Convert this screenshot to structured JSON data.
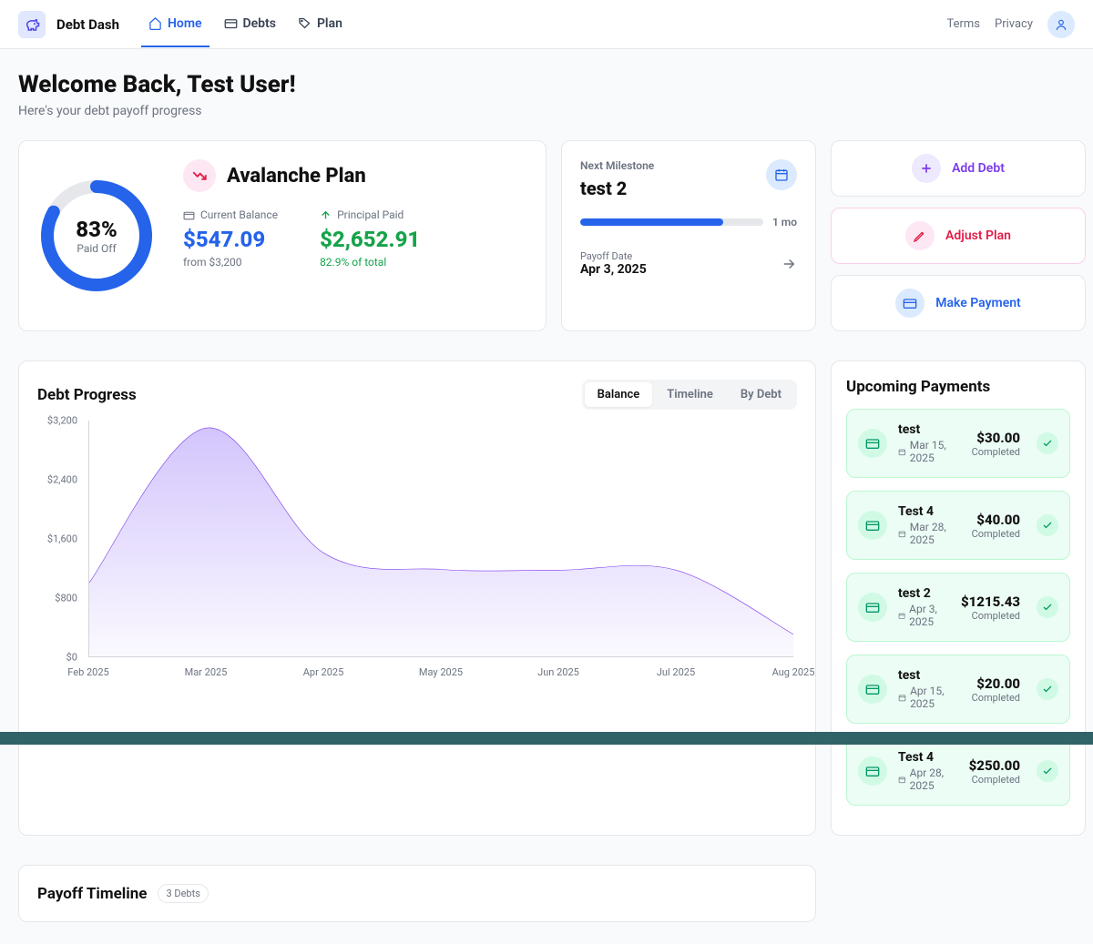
{
  "brand": "Debt Dash",
  "nav": {
    "items": [
      {
        "label": "Home",
        "active": true,
        "icon": "home"
      },
      {
        "label": "Debts",
        "active": false,
        "icon": "card"
      },
      {
        "label": "Plan",
        "active": false,
        "icon": "tag"
      }
    ],
    "links": [
      "Terms",
      "Privacy"
    ]
  },
  "welcome": {
    "title": "Welcome Back, Test User!",
    "subtitle": "Here's your debt payoff progress"
  },
  "hero": {
    "progress_pct": "83%",
    "progress_label": "Paid Off",
    "progress_value": 83,
    "plan_name": "Avalanche Plan",
    "balance": {
      "label": "Current Balance",
      "value": "$547.09",
      "sub": "from $3,200"
    },
    "principal": {
      "label": "Principal Paid",
      "value": "$2,652.91",
      "sub": "82.9% of total"
    }
  },
  "milestone": {
    "label": "Next Milestone",
    "name": "test 2",
    "progress": 78,
    "time": "1 mo",
    "payoff_label": "Payoff Date",
    "payoff_date": "Apr 3, 2025"
  },
  "actions": {
    "add_debt": "Add Debt",
    "adjust_plan": "Adjust Plan",
    "make_payment": "Make Payment"
  },
  "chart": {
    "title": "Debt Progress",
    "tabs": [
      "Balance",
      "Timeline",
      "By Debt"
    ],
    "active_tab": 0
  },
  "chart_data": {
    "type": "area",
    "title": "Debt Progress",
    "xlabel": "",
    "ylabel": "",
    "ylim": [
      0,
      3200
    ],
    "categories": [
      "Feb 2025",
      "Mar 2025",
      "Apr 2025",
      "May 2025",
      "Jun 2025",
      "Jul 2025",
      "Aug 2025"
    ],
    "y_ticks": [
      "$3,200",
      "$2,400",
      "$1,600",
      "$800",
      "$0"
    ],
    "values": [
      1000,
      3100,
      1400,
      1180,
      1170,
      1170,
      300
    ],
    "color": "#7c3aed"
  },
  "upcoming": {
    "title": "Upcoming Payments",
    "items": [
      {
        "name": "test",
        "date": "Mar 15, 2025",
        "amount": "$30.00",
        "status": "Completed"
      },
      {
        "name": "Test 4",
        "date": "Mar 28, 2025",
        "amount": "$40.00",
        "status": "Completed"
      },
      {
        "name": "test 2",
        "date": "Apr 3, 2025",
        "amount": "$1215.43",
        "status": "Completed"
      },
      {
        "name": "test",
        "date": "Apr 15, 2025",
        "amount": "$20.00",
        "status": "Completed"
      },
      {
        "name": "Test 4",
        "date": "Apr 28, 2025",
        "amount": "$250.00",
        "status": "Completed"
      }
    ]
  },
  "timeline": {
    "title": "Payoff Timeline",
    "badge": "3 Debts"
  }
}
